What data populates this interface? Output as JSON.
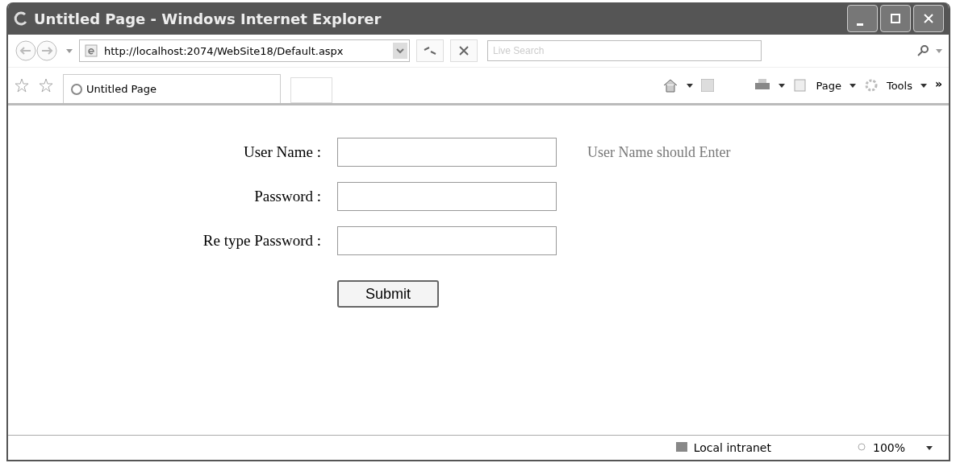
{
  "window": {
    "title": "Untitled Page - Windows Internet Explorer"
  },
  "address_bar": {
    "value": "http://localhost:2074/WebSite18/Default.aspx"
  },
  "search": {
    "placeholder": "Live Search"
  },
  "tabs": [
    {
      "label": "Untitled Page",
      "selected": true
    }
  ],
  "toolbar": {
    "page": "Page",
    "tools": "Tools",
    "more": "»"
  },
  "form": {
    "fields": [
      {
        "label": "User Name :",
        "error": "User Name should Enter"
      },
      {
        "label": "Password :"
      },
      {
        "label": "Re type Password :"
      }
    ],
    "submit": "Submit"
  },
  "status_bar": {
    "zone": "Local intranet",
    "zoom": "100%"
  }
}
